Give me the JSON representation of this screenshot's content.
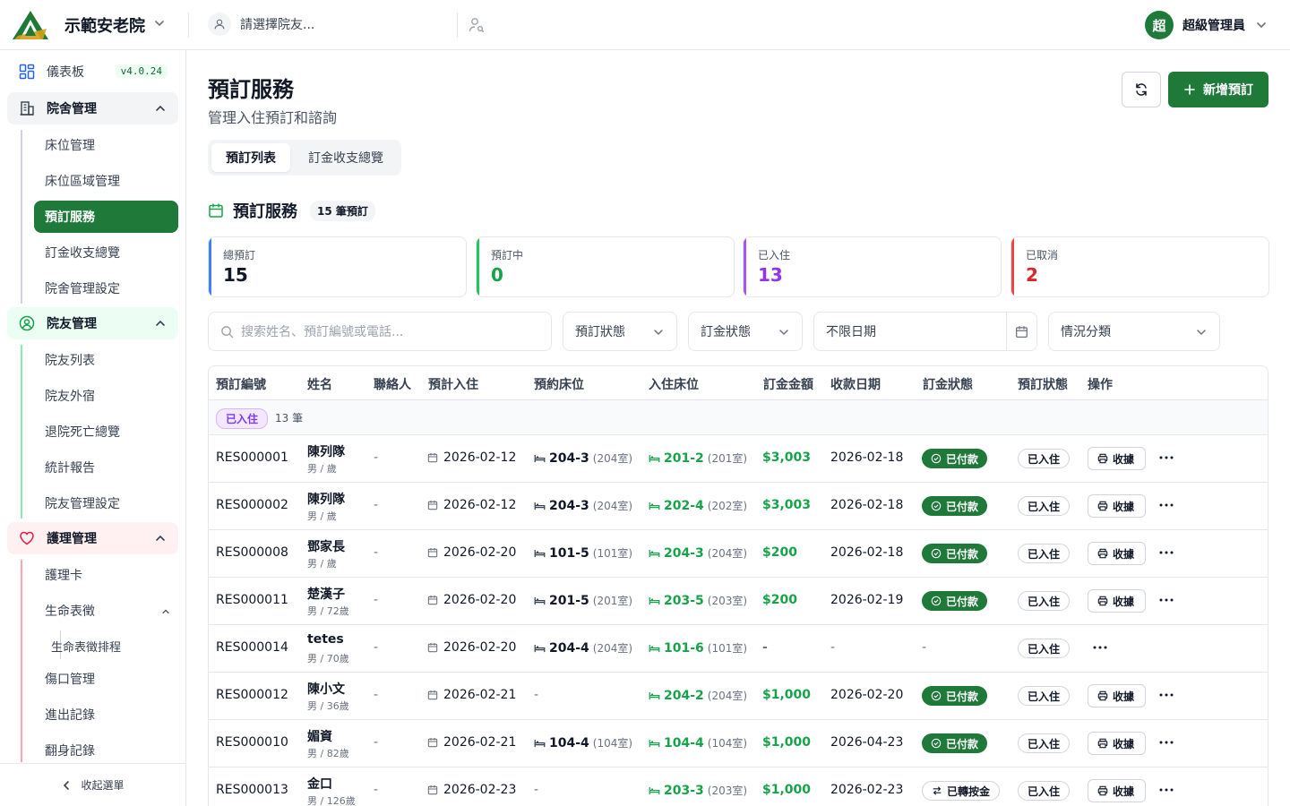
{
  "topbar": {
    "org_name": "示範安老院",
    "resident_placeholder": "請選擇院友...",
    "user_initial": "超",
    "user_name": "超級管理員"
  },
  "sidebar": {
    "dashboard": "儀表板",
    "version": "v4.0.24",
    "facility": {
      "label": "院舍管理",
      "items": [
        "床位管理",
        "床位區域管理",
        "預訂服務",
        "訂金收支總覽",
        "院舍管理設定"
      ]
    },
    "resident": {
      "label": "院友管理",
      "items": [
        "院友列表",
        "院友外宿",
        "退院死亡總覽",
        "統計報告",
        "院友管理設定"
      ]
    },
    "care": {
      "label": "護理管理",
      "items": [
        "護理卡",
        "生命表徵",
        "生命表徵排程",
        "傷口管理",
        "進出記錄",
        "翻身記錄"
      ]
    },
    "collapse": "收起選單"
  },
  "header": {
    "title": "預訂服務",
    "subtitle": "管理入住預訂和諮詢",
    "add_label": "新增預訂"
  },
  "tabs": [
    "預訂列表",
    "訂金收支總覽"
  ],
  "section": {
    "title": "預訂服務",
    "count": "15 筆預訂"
  },
  "stats": [
    {
      "label": "總預訂",
      "value": "15",
      "color": "#3b82f6",
      "value_color": "#111827"
    },
    {
      "label": "預訂中",
      "value": "0",
      "color": "#22c55e",
      "value_color": "#16a34a"
    },
    {
      "label": "已入住",
      "value": "13",
      "color": "#a855f7",
      "value_color": "#9333ea"
    },
    {
      "label": "已取消",
      "value": "2",
      "color": "#ef4444",
      "value_color": "#dc2626"
    }
  ],
  "filters": {
    "search_placeholder": "搜索姓名、預訂編號或電話...",
    "booking_status": "預訂狀態",
    "deposit_status": "訂金狀態",
    "date": "不限日期",
    "category": "情況分類"
  },
  "table": {
    "headers": [
      "預訂編號",
      "姓名",
      "聯絡人",
      "預計入住",
      "預約床位",
      "入住床位",
      "訂金金額",
      "收款日期",
      "訂金狀態",
      "預訂狀態",
      "操作"
    ],
    "group": {
      "label": "已入住",
      "count": "13 筆"
    },
    "rows": [
      {
        "id": "RES000001",
        "name": "陳列隊",
        "meta": "男 / 歲",
        "contact": "-",
        "checkin": "2026-02-12",
        "booked_bed": "204-3",
        "booked_room": "(204室)",
        "bed": "201-2",
        "room": "(201室)",
        "amount": "$3,003",
        "paid_date": "2026-02-18",
        "deposit": "已付款",
        "deposit_type": "paid",
        "status": "已入住",
        "receipt": "收據"
      },
      {
        "id": "RES000002",
        "name": "陳列隊",
        "meta": "男 / 歲",
        "contact": "-",
        "checkin": "2026-02-12",
        "booked_bed": "204-3",
        "booked_room": "(204室)",
        "bed": "202-4",
        "room": "(202室)",
        "amount": "$3,003",
        "paid_date": "2026-02-18",
        "deposit": "已付款",
        "deposit_type": "paid",
        "status": "已入住",
        "receipt": "收據"
      },
      {
        "id": "RES000008",
        "name": "鄧家長",
        "meta": "男 / 歲",
        "contact": "-",
        "checkin": "2026-02-20",
        "booked_bed": "101-5",
        "booked_room": "(101室)",
        "bed": "204-3",
        "room": "(204室)",
        "amount": "$200",
        "paid_date": "2026-02-18",
        "deposit": "已付款",
        "deposit_type": "paid",
        "status": "已入住",
        "receipt": "收據"
      },
      {
        "id": "RES000011",
        "name": "楚漢子",
        "meta": "男 / 72歲",
        "contact": "-",
        "checkin": "2026-02-20",
        "booked_bed": "201-5",
        "booked_room": "(201室)",
        "bed": "203-5",
        "room": "(203室)",
        "amount": "$200",
        "paid_date": "2026-02-19",
        "deposit": "已付款",
        "deposit_type": "paid",
        "status": "已入住",
        "receipt": "收據"
      },
      {
        "id": "RES000014",
        "name": "tetes",
        "meta": "男 / 70歲",
        "contact": "-",
        "checkin": "2026-02-20",
        "booked_bed": "204-4",
        "booked_room": "(204室)",
        "bed": "101-6",
        "room": "(101室)",
        "amount": "-",
        "paid_date": "-",
        "deposit": "-",
        "deposit_type": "none",
        "status": "已入住",
        "receipt": ""
      },
      {
        "id": "RES000012",
        "name": "陳小文",
        "meta": "男 / 36歲",
        "contact": "-",
        "checkin": "2026-02-21",
        "booked_bed": "",
        "booked_room": "",
        "bed": "204-2",
        "room": "(204室)",
        "amount": "$1,000",
        "paid_date": "2026-02-20",
        "deposit": "已付款",
        "deposit_type": "paid",
        "status": "已入住",
        "receipt": "收據"
      },
      {
        "id": "RES000010",
        "name": "媚資",
        "meta": "男 / 82歲",
        "contact": "-",
        "checkin": "2026-02-21",
        "booked_bed": "104-4",
        "booked_room": "(104室)",
        "bed": "104-4",
        "room": "(104室)",
        "amount": "$1,000",
        "paid_date": "2026-04-23",
        "deposit": "已付款",
        "deposit_type": "paid",
        "status": "已入住",
        "receipt": "收據"
      },
      {
        "id": "RES000013",
        "name": "金口",
        "meta": "男 / 126歲",
        "contact": "-",
        "checkin": "2026-02-23",
        "booked_bed": "",
        "booked_room": "",
        "bed": "203-3",
        "room": "(203室)",
        "amount": "$1,000",
        "paid_date": "2026-02-23",
        "deposit": "已轉按金",
        "deposit_type": "transfer",
        "status": "已入住",
        "receipt": "收據"
      }
    ]
  },
  "colors": {
    "primary": "#1f7a3a",
    "care_accent": "#e11d48",
    "resident_accent": "#16a34a"
  }
}
